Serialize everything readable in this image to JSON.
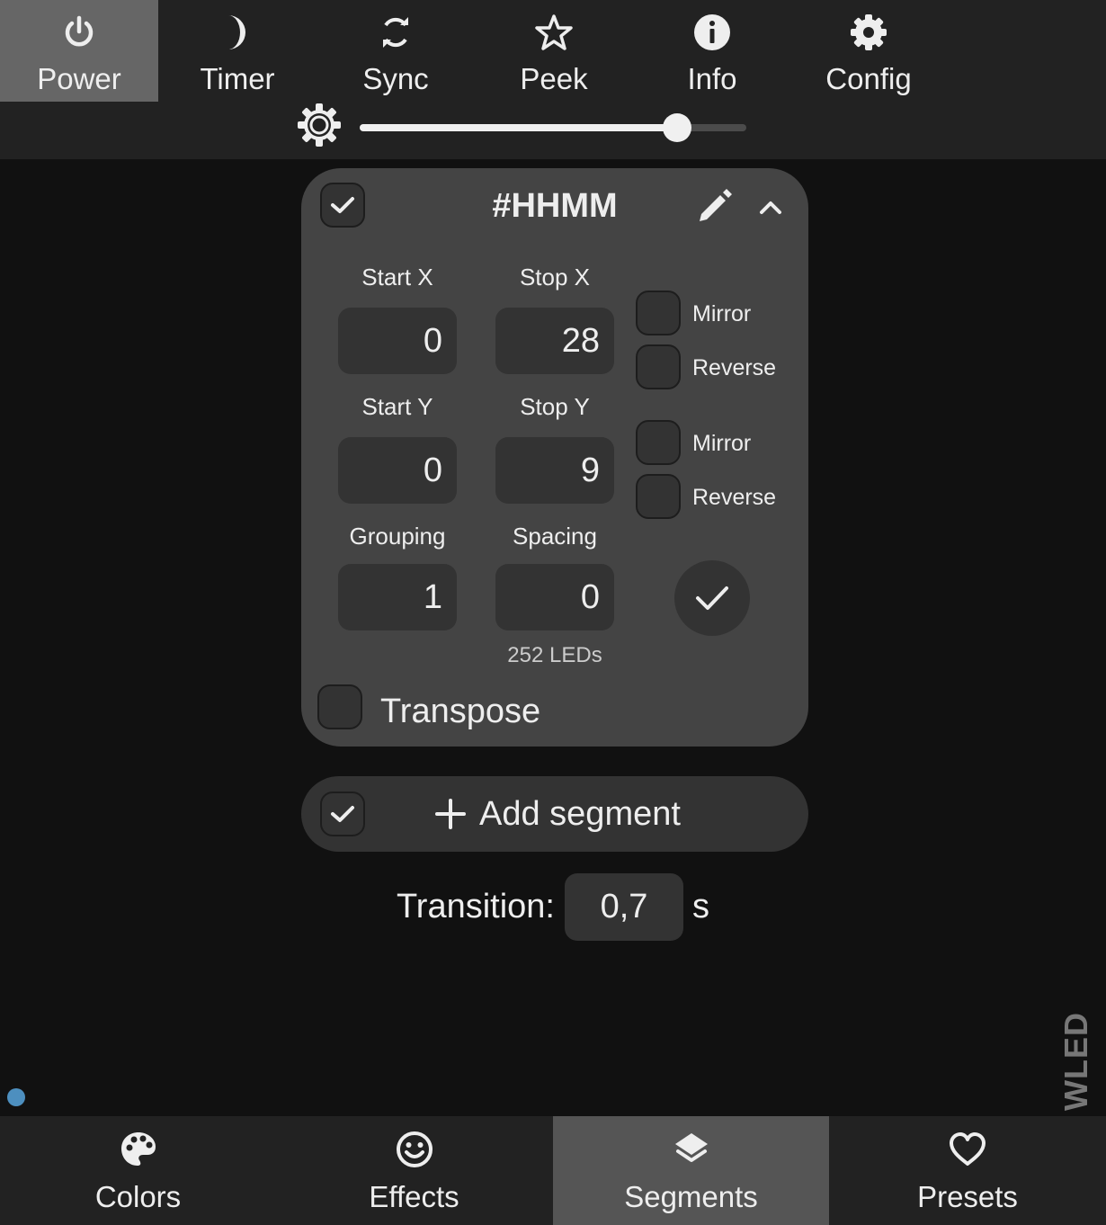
{
  "top_tabs": [
    {
      "label": "Power",
      "icon": "power-icon",
      "active": true
    },
    {
      "label": "Timer",
      "icon": "moon-icon",
      "active": false
    },
    {
      "label": "Sync",
      "icon": "sync-icon",
      "active": false
    },
    {
      "label": "Peek",
      "icon": "star-icon",
      "active": false
    },
    {
      "label": "Info",
      "icon": "info-icon",
      "active": false
    },
    {
      "label": "Config",
      "icon": "gear-icon",
      "active": false
    }
  ],
  "brightness": {
    "icon": "brightness-icon",
    "level_percent": 82
  },
  "segment": {
    "name": "#HHMM",
    "selected": true,
    "start_x_label": "Start X",
    "stop_x_label": "Stop X",
    "start_x": "0",
    "stop_x": "28",
    "start_y_label": "Start Y",
    "stop_y_label": "Stop Y",
    "start_y": "0",
    "stop_y": "9",
    "grouping_label": "Grouping",
    "spacing_label": "Spacing",
    "grouping": "1",
    "spacing": "0",
    "mirror_x_label": "Mirror",
    "reverse_x_label": "Reverse",
    "mirror_y_label": "Mirror",
    "reverse_y_label": "Reverse",
    "led_count": "252 LEDs",
    "transpose_label": "Transpose"
  },
  "add_segment": {
    "label": "Add segment",
    "checked": true
  },
  "transition": {
    "label": "Transition:",
    "value": "0,7",
    "unit": "s"
  },
  "brand": "WLED",
  "bottom_tabs": [
    {
      "label": "Colors",
      "icon": "palette-icon",
      "active": false
    },
    {
      "label": "Effects",
      "icon": "smiley-icon",
      "active": false
    },
    {
      "label": "Segments",
      "icon": "layers-icon",
      "active": true
    },
    {
      "label": "Presets",
      "icon": "heart-icon",
      "active": false
    }
  ],
  "colors": {
    "accent_dot": "#4d8fbf",
    "active_tab": "#666666"
  }
}
